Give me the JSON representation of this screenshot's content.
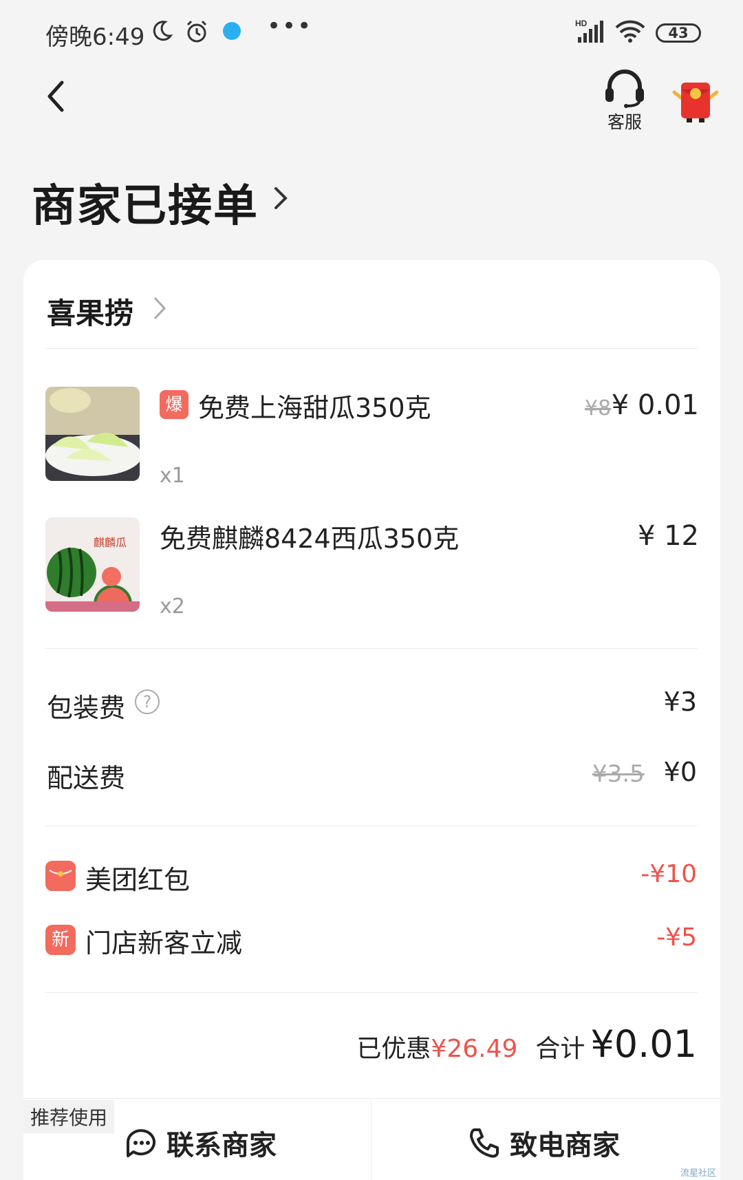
{
  "status_bar": {
    "time": "傍晚6:49",
    "network": "HD",
    "battery": "43",
    "more": "•••"
  },
  "nav": {
    "service_label": "客服"
  },
  "order": {
    "status_title": "商家已接单"
  },
  "shop": {
    "name": "喜果捞"
  },
  "items": [
    {
      "badge": "爆",
      "name": "免费上海甜瓜350克",
      "qty": "x1",
      "old_price": "¥8",
      "price": "¥ 0.01"
    },
    {
      "name": "免费麒麟8424西瓜350克",
      "qty": "x2",
      "price": "¥ 12",
      "thumb_text": "麒麟瓜"
    }
  ],
  "fees": {
    "packing_label": "包装费",
    "packing_help": "?",
    "packing_value": "¥3",
    "delivery_label": "配送费",
    "delivery_old": "¥3.5",
    "delivery_value": "¥0"
  },
  "discounts": [
    {
      "label": "美团红包",
      "value": "-¥10",
      "icon": "red-packet-icon"
    },
    {
      "label": "门店新客立减",
      "value": "-¥5",
      "icon": "new-customer-icon",
      "icon_text": "新"
    }
  ],
  "summary": {
    "saved_label": "已优惠",
    "saved_value": "¥26.49",
    "total_label": "合计",
    "total_value": "¥0.01"
  },
  "actions": {
    "recommend_tag": "推荐使用",
    "contact_label": "联系商家",
    "call_label": "致电商家"
  },
  "watermark": "流星社区",
  "colors": {
    "accent_red": "#f0524b",
    "badge_red": "#f36a5e",
    "background": "#f4f4f4"
  }
}
